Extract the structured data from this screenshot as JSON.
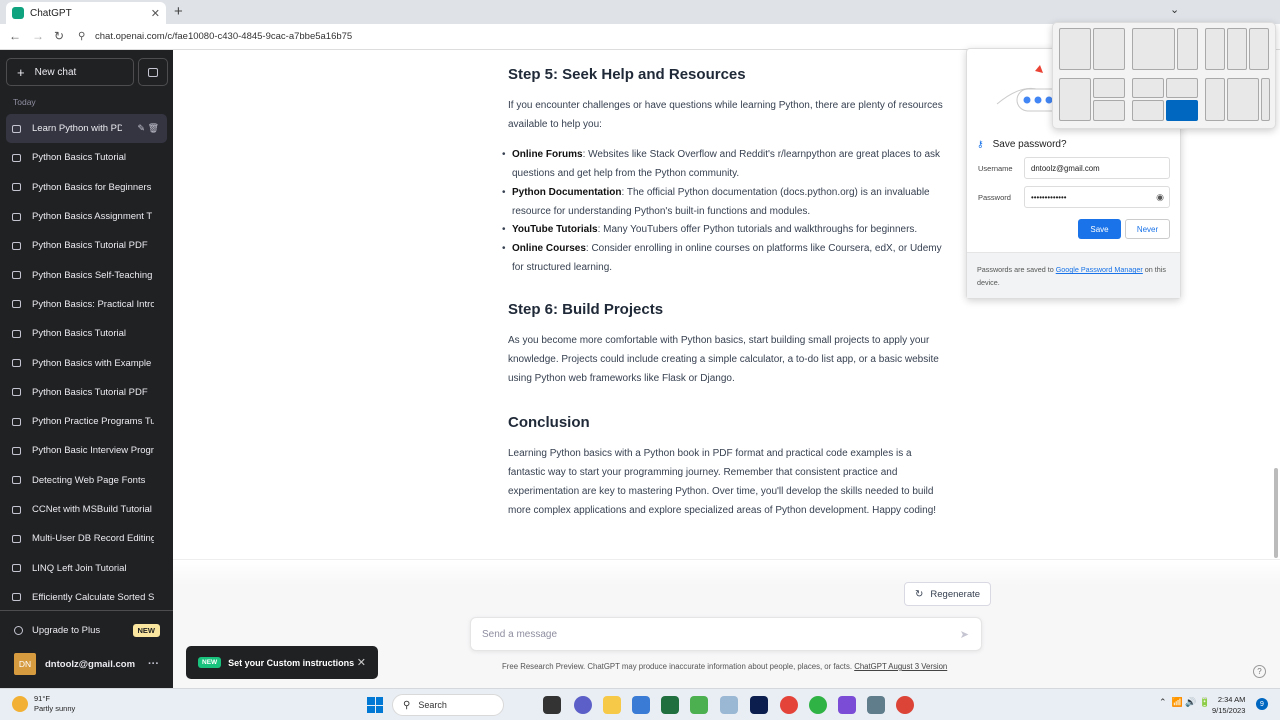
{
  "browser": {
    "tab_title": "ChatGPT",
    "tab_close": "✕",
    "new_tab": "+",
    "url": "chat.openai.com/c/fae10080-c430-4845-9cac-a7bbe5a16b75",
    "back": "←",
    "forward": "→",
    "reload": "↻"
  },
  "sidebar": {
    "new_chat": "New chat",
    "section_label": "Today",
    "chats": [
      "Learn Python with PD",
      "Python Basics Tutorial",
      "Python Basics for Beginners",
      "Python Basics Assignment T",
      "Python Basics Tutorial PDF",
      "Python Basics Self-Teaching",
      "Python Basics: Practical Intro",
      "Python Basics Tutorial",
      "Python Basics with Example",
      "Python Basics Tutorial PDF",
      "Python Practice Programs Tu",
      "Python Basic Interview Progr",
      "Detecting Web Page Fonts",
      "CCNet with MSBuild Tutorial",
      "Multi-User DB Record Editing",
      "LINQ Left Join Tutorial",
      "Efficiently Calculate Sorted S"
    ],
    "active_actions": "✎ 🗑",
    "upgrade": "Upgrade to Plus",
    "upgrade_badge": "NEW",
    "account_initials": "DN",
    "account_email": "dntoolz@gmail.com",
    "account_menu": "···"
  },
  "article": {
    "step5_title": "Step 5: Seek Help and Resources",
    "step5_intro": "If you encounter challenges or have questions while learning Python, there are plenty of resources available to help you:",
    "resources": [
      {
        "term": "Online Forums",
        "text": ": Websites like Stack Overflow and Reddit's r/learnpython are great places to ask questions and get help from the Python community."
      },
      {
        "term": "Python Documentation",
        "text": ": The official Python documentation (docs.python.org) is an invaluable resource for understanding Python's built-in functions and modules."
      },
      {
        "term": "YouTube Tutorials",
        "text": ": Many YouTubers offer Python tutorials and walkthroughs for beginners."
      },
      {
        "term": "Online Courses",
        "text": ": Consider enrolling in online courses on platforms like Coursera, edX, or Udemy for structured learning."
      }
    ],
    "step6_title": "Step 6: Build Projects",
    "step6_text": "As you become more comfortable with Python basics, start building small projects to apply your knowledge. Projects could include creating a simple calculator, a to-do list app, or a basic website using Python web frameworks like Flask or Django.",
    "conclusion_title": "Conclusion",
    "conclusion_text": "Learning Python basics with a Python book in PDF format and practical code examples is a fantastic way to start your programming journey. Remember that consistent practice and experimentation are key to mastering Python. Over time, you'll develop the skills needed to build more complex applications and explore specialized areas of Python development. Happy coding!"
  },
  "composer": {
    "regenerate": "Regenerate",
    "placeholder": "Send a message",
    "footnote_prefix": "Free Research Preview. ChatGPT may produce inaccurate information about people, places, or facts. ",
    "footnote_link": "ChatGPT August 3 Version",
    "help": "?"
  },
  "toast": {
    "badge": "NEW",
    "text": "Set your Custom instructions",
    "close": "✕"
  },
  "password_popup": {
    "title": "Save password?",
    "username_label": "Username",
    "username_value": "dntoolz@gmail.com",
    "password_label": "Password",
    "password_value": "•••••••••••••",
    "save": "Save",
    "never": "Never",
    "footer_prefix": "Passwords are saved to ",
    "footer_link": "Google Password Manager",
    "footer_suffix": " on this device."
  },
  "taskbar": {
    "temperature": "91°F",
    "weather": "Partly sunny",
    "search": "Search",
    "time": "2:34 AM",
    "date": "9/15/2023",
    "notifications": "9"
  },
  "colors": {
    "sidebar_bg": "#202123",
    "accent_green": "#10a37f",
    "chrome_blue": "#1a73e8",
    "snap_selected": "#0067c0"
  }
}
